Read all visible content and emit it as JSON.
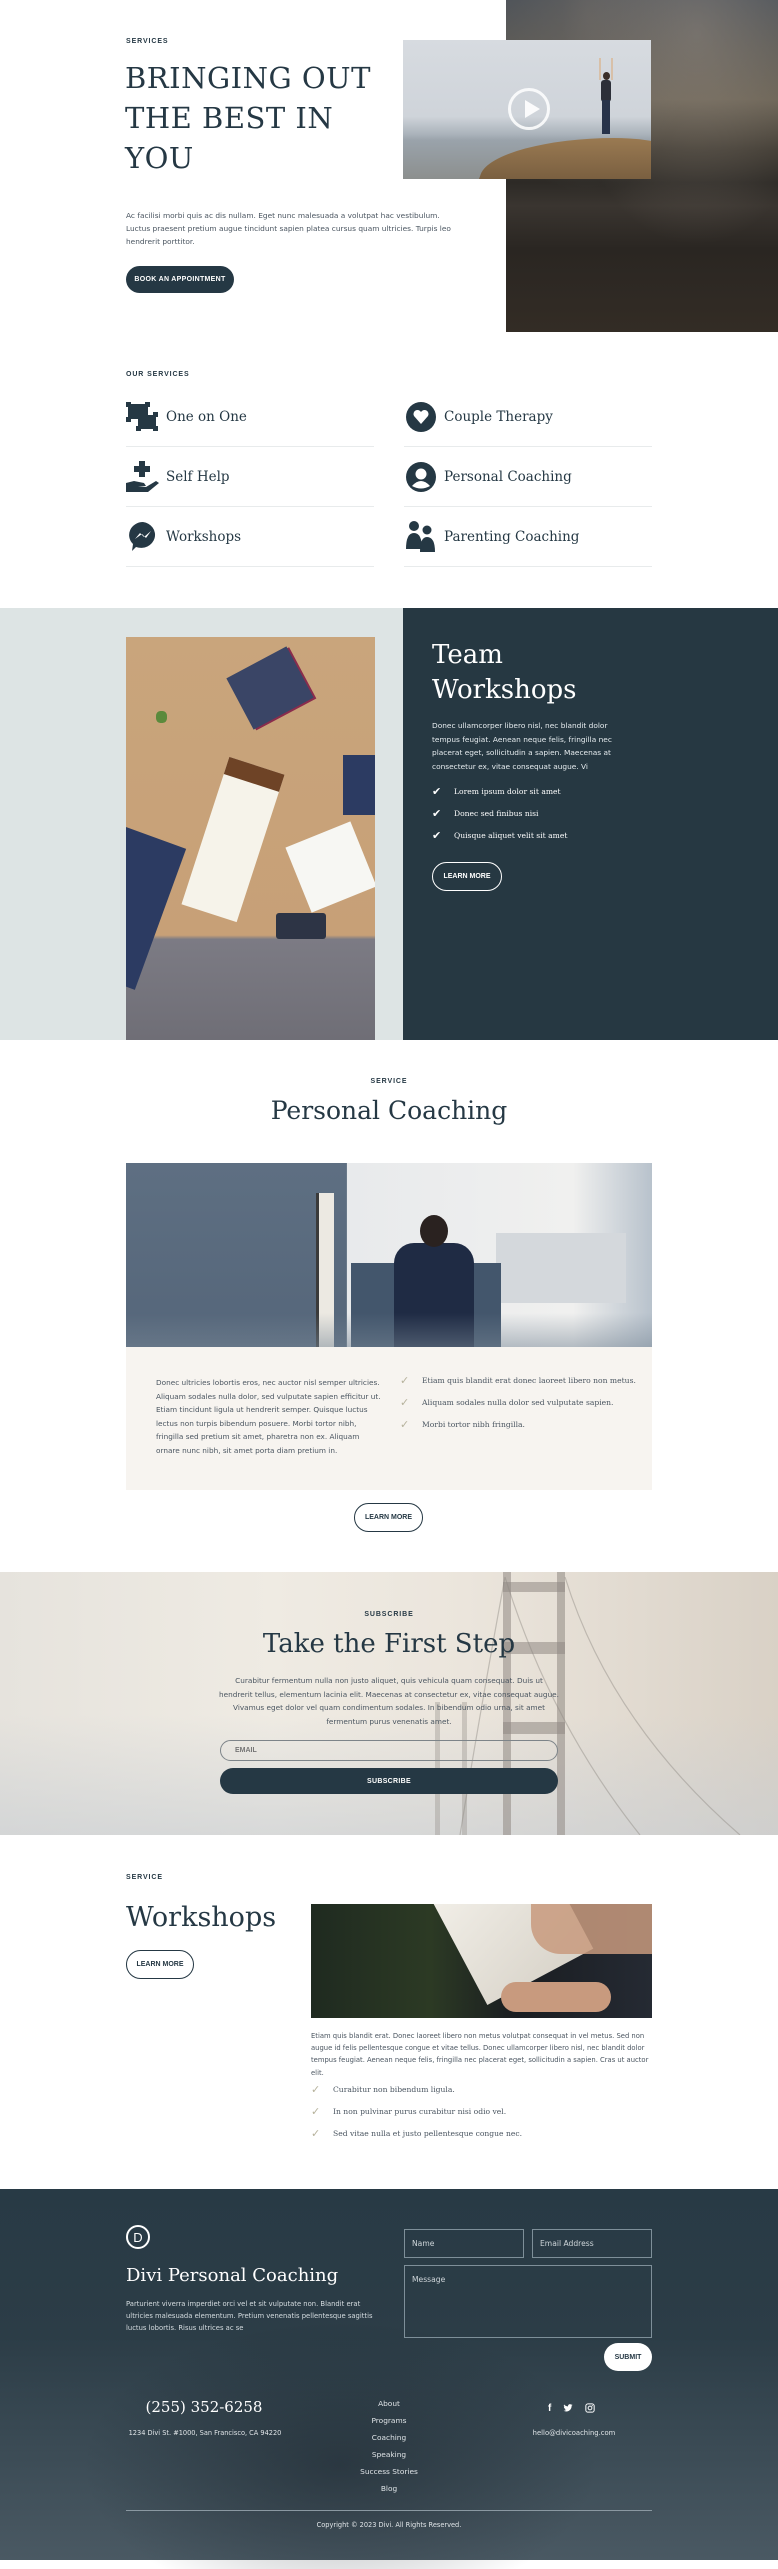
{
  "hero": {
    "eyebrow": "SERVICES",
    "title_lines": [
      "BRINGING OUT",
      "THE BEST IN",
      "YOU"
    ],
    "description": "Ac facilisi morbi quis ac dis nullam. Eget nunc malesuada a volutpat hac vestibulum. Luctus praesent pretium augue tincidunt sapien platea cursus quam ultricies. Turpis leo hendrerit porttitor.",
    "cta_label": "BOOK AN APPOINTMENT",
    "video_icon": "play-icon"
  },
  "services": {
    "eyebrow": "OUR SERVICES",
    "items": [
      {
        "label": "One on One",
        "icon": "vector-square-icon"
      },
      {
        "label": "Couple Therapy",
        "icon": "heart-circle-icon"
      },
      {
        "label": "Self Help",
        "icon": "hand-holding-medical-icon"
      },
      {
        "label": "Personal Coaching",
        "icon": "user-circle-icon"
      },
      {
        "label": "Workshops",
        "icon": "messenger-icon"
      },
      {
        "label": "Parenting Coaching",
        "icon": "user-friends-icon"
      }
    ]
  },
  "team_workshops": {
    "title_lines": [
      "Team",
      "Workshops"
    ],
    "description": "Donec ullamcorper libero nisl, nec blandit dolor tempus feugiat. Aenean neque felis, fringilla nec placerat eget, sollicitudin a sapien. Maecenas at consectetur ex, vitae consequat augue. Vi",
    "checklist": [
      "Lorem ipsum dolor sit amet",
      "Donec sed finibus nisi",
      "Quisque aliquet velit sit amet"
    ],
    "button_label": "LEARN MORE"
  },
  "personal_coaching": {
    "eyebrow": "SERVICE",
    "title": "Personal Coaching",
    "description": "Donec ultricies lobortis eros, nec auctor nisl semper ultricies. Aliquam sodales nulla dolor, sed vulputate sapien efficitur ut. Etiam tincidunt ligula ut hendrerit semper. Quisque luctus lectus non turpis bibendum posuere. Morbi tortor nibh, fringilla sed pretium sit amet, pharetra non ex. Aliquam ornare nunc nibh, sit amet porta diam pretium in.",
    "checklist": [
      "Etiam quis blandit erat donec laoreet libero non metus.",
      "Aliquam sodales nulla dolor sed vulputate sapien.",
      "Morbi tortor nibh fringilla."
    ],
    "button_label": "LEARN MORE"
  },
  "subscribe": {
    "eyebrow": "SUBSCRIBE",
    "title": "Take the First Step",
    "description": "Curabitur fermentum nulla non justo aliquet, quis vehicula quam consequat. Duis ut hendrerit tellus, elementum lacinia elit. Maecenas at consectetur ex, vitae consequat augue. Vivamus eget dolor vel quam condimentum sodales. In bibendum odio urna, sit amet fermentum purus venenatis amet.",
    "email_placeholder": "EMAIL",
    "button_label": "SUBSCRIBE"
  },
  "workshops": {
    "eyebrow": "SERVICE",
    "title": "Workshops",
    "button_label": "LEARN MORE",
    "description": "Etiam quis blandit erat. Donec laoreet libero non metus volutpat consequat in vel metus. Sed non augue id felis pellentesque congue et vitae tellus. Donec ullamcorper libero nisl, nec blandit dolor tempus feugiat. Aenean neque felis, fringilla nec placerat eget, sollicitudin a sapien. Cras ut auctor elit.",
    "checklist": [
      "Curabitur non bibendum ligula.",
      "In non pulvinar purus curabitur nisi odio vel.",
      "Sed vitae nulla et justo pellentesque congue nec."
    ]
  },
  "footer": {
    "logo_letter": "D",
    "brand": "Divi Personal Coaching",
    "description": "Parturient viverra imperdiet orci vel et sit vulputate non. Blandit erat ultricies malesuada elementum. Pretium venenatis pellentesque sagittis luctus lobortis. Risus ultrices ac se",
    "form": {
      "name_placeholder": "Name",
      "email_placeholder": "Email Address",
      "message_placeholder": "Message",
      "submit_label": "SUBMIT"
    },
    "phone": "(255) 352-6258",
    "address": "1234 Divi St. #1000, San Francisco, CA 94220",
    "nav": [
      "About",
      "Programs",
      "Coaching",
      "Speaking",
      "Success Stories",
      "Blog"
    ],
    "social": [
      "facebook-icon",
      "twitter-icon",
      "instagram-icon"
    ],
    "email": "hello@divicoaching.com",
    "copyright": "Copyright © 2023 Divi. All Rights Reserved."
  },
  "colors": {
    "primary": "#253844",
    "light_bg": "#dde4e4",
    "cream_panel": "#f7f4f0",
    "check_muted": "#b6b29c"
  }
}
